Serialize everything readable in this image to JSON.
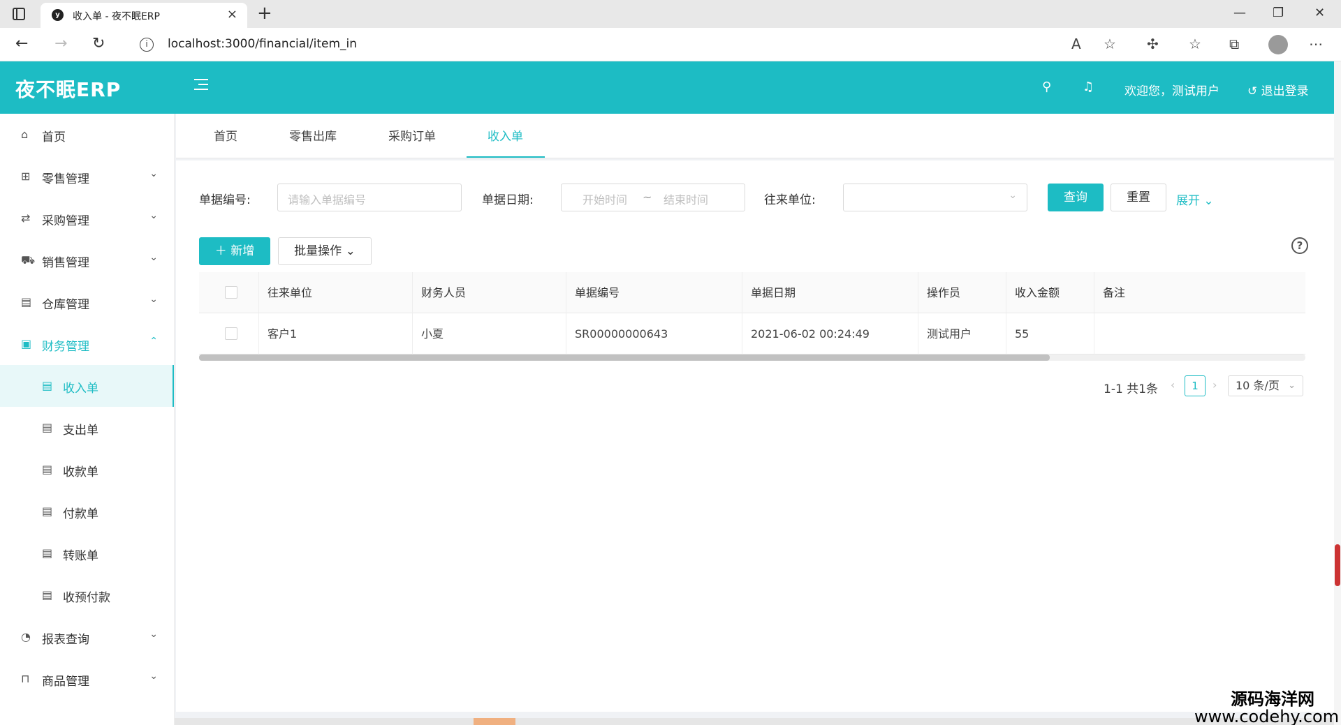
{
  "browser": {
    "tab_title": "收入单 - 夜不眠ERP",
    "url": "localhost:3000/financial/item_in"
  },
  "header": {
    "logo": "夜不眠ERP",
    "welcome": "欢迎您，测试用户",
    "logout": "退出登录"
  },
  "sidebar": {
    "items": [
      {
        "label": "首页",
        "icon": "home-icon"
      },
      {
        "label": "零售管理",
        "icon": "gift-icon"
      },
      {
        "label": "采购管理",
        "icon": "swap-icon"
      },
      {
        "label": "销售管理",
        "icon": "cart-icon"
      },
      {
        "label": "仓库管理",
        "icon": "warehouse-icon"
      },
      {
        "label": "财务管理",
        "icon": "finance-icon"
      },
      {
        "label": "收入单",
        "icon": "doc-icon"
      },
      {
        "label": "支出单",
        "icon": "doc-icon"
      },
      {
        "label": "收款单",
        "icon": "doc-icon"
      },
      {
        "label": "付款单",
        "icon": "doc-icon"
      },
      {
        "label": "转账单",
        "icon": "doc-icon"
      },
      {
        "label": "收预付款",
        "icon": "doc-icon"
      },
      {
        "label": "报表查询",
        "icon": "chart-icon"
      },
      {
        "label": "商品管理",
        "icon": "bag-icon"
      }
    ]
  },
  "page_tabs": [
    "首页",
    "零售出库",
    "采购订单",
    "收入单"
  ],
  "filters": {
    "bill_no_label": "单据编号:",
    "bill_no_placeholder": "请输入单据编号",
    "date_label": "单据日期:",
    "start_placeholder": "开始时间",
    "range_sep": "~",
    "end_placeholder": "结束时间",
    "partner_label": "往来单位:",
    "query": "查询",
    "reset": "重置",
    "expand": "展开"
  },
  "toolbar": {
    "add": "新增",
    "batch": "批量操作"
  },
  "table": {
    "columns": [
      "往来单位",
      "财务人员",
      "单据编号",
      "单据日期",
      "操作员",
      "收入金额",
      "备注"
    ],
    "rows": [
      [
        "客户1",
        "小夏",
        "SR00000000643",
        "2021-06-02 00:24:49",
        "测试用户",
        "55",
        ""
      ]
    ]
  },
  "pagination": {
    "total": "1-1 共1条",
    "current": "1",
    "page_size": "10 条/页"
  },
  "watermark": {
    "line1": "源码海洋网",
    "line2": "www.codehy.com"
  },
  "colors": {
    "primary": "#1dbcc4"
  }
}
